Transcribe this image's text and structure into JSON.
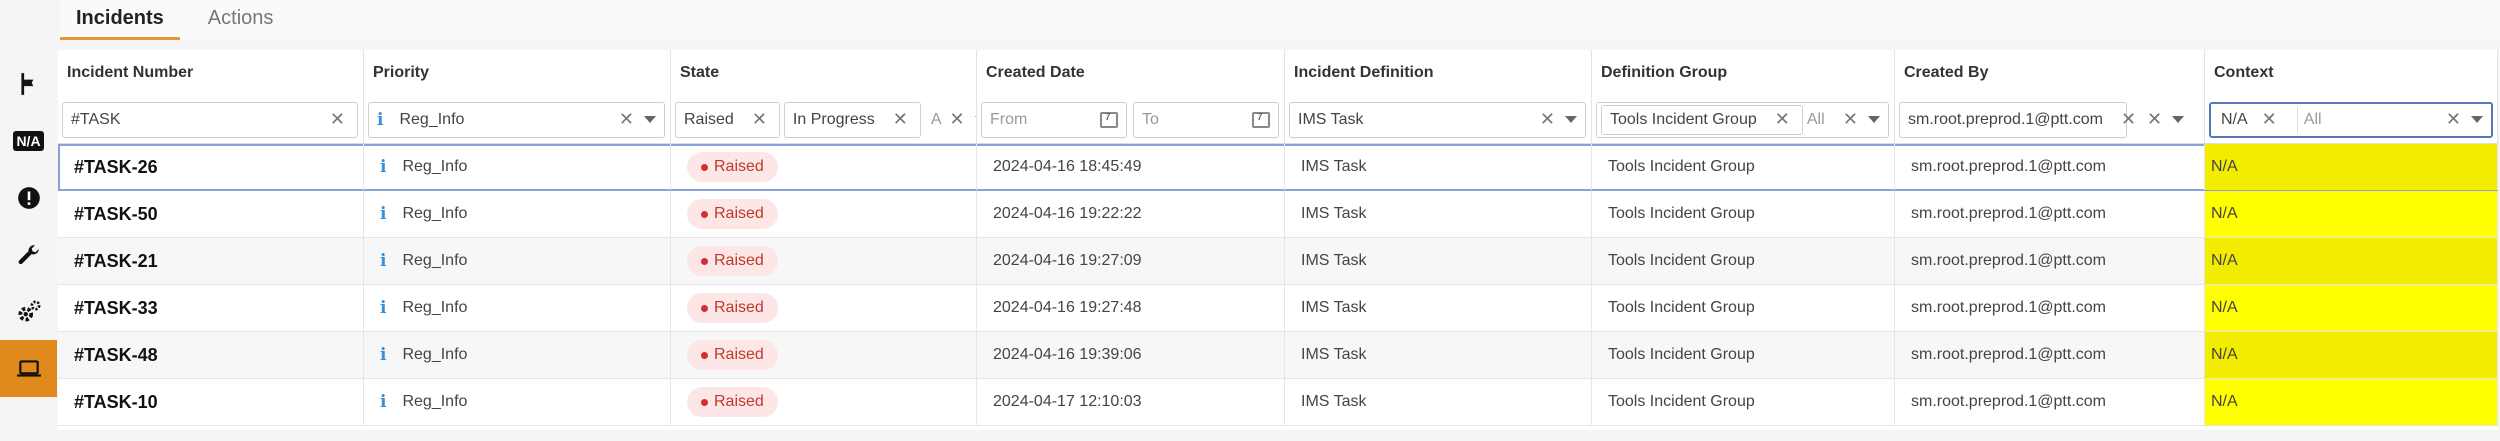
{
  "tabs": [
    {
      "label": "Incidents",
      "active": true
    },
    {
      "label": "Actions",
      "active": false
    }
  ],
  "sidebar": {
    "items": [
      {
        "icon": "flag-icon"
      },
      {
        "icon": "na-icon",
        "text": "N/A"
      },
      {
        "icon": "alert-icon"
      },
      {
        "icon": "wrench-icon"
      },
      {
        "icon": "gears-icon"
      },
      {
        "icon": "laptop-icon",
        "active": true
      }
    ]
  },
  "columns": [
    "Incident Number",
    "Priority",
    "State",
    "Created Date",
    "Incident Definition",
    "Definition Group",
    "Created By",
    "Context"
  ],
  "filters": {
    "incident_number": "#TASK",
    "priority": "Reg_Info",
    "state_chips": [
      "Raised",
      "In Progress"
    ],
    "state_more": "A",
    "date_from_placeholder": "From",
    "date_to_placeholder": "To",
    "incident_definition": "IMS Task",
    "definition_group_chip": "Tools Incident Group",
    "definition_group_all": "All",
    "created_by": "sm.root.preprod.1@ptt.com",
    "context_chip": "N/A",
    "context_all": "All"
  },
  "rows": [
    {
      "number": "#TASK-26",
      "priority": "Reg_Info",
      "state": "Raised",
      "created": "2024-04-16 18:45:49",
      "definition": "IMS Task",
      "group": "Tools Incident Group",
      "created_by": "sm.root.preprod.1@ptt.com",
      "context": "N/A"
    },
    {
      "number": "#TASK-50",
      "priority": "Reg_Info",
      "state": "Raised",
      "created": "2024-04-16 19:22:22",
      "definition": "IMS Task",
      "group": "Tools Incident Group",
      "created_by": "sm.root.preprod.1@ptt.com",
      "context": "N/A"
    },
    {
      "number": "#TASK-21",
      "priority": "Reg_Info",
      "state": "Raised",
      "created": "2024-04-16 19:27:09",
      "definition": "IMS Task",
      "group": "Tools Incident Group",
      "created_by": "sm.root.preprod.1@ptt.com",
      "context": "N/A"
    },
    {
      "number": "#TASK-33",
      "priority": "Reg_Info",
      "state": "Raised",
      "created": "2024-04-16 19:27:48",
      "definition": "IMS Task",
      "group": "Tools Incident Group",
      "created_by": "sm.root.preprod.1@ptt.com",
      "context": "N/A"
    },
    {
      "number": "#TASK-48",
      "priority": "Reg_Info",
      "state": "Raised",
      "created": "2024-04-16 19:39:06",
      "definition": "IMS Task",
      "group": "Tools Incident Group",
      "created_by": "sm.root.preprod.1@ptt.com",
      "context": "N/A"
    },
    {
      "number": "#TASK-10",
      "priority": "Reg_Info",
      "state": "Raised",
      "created": "2024-04-17 12:10:03",
      "definition": "IMS Task",
      "group": "Tools Incident Group",
      "created_by": "sm.root.preprod.1@ptt.com",
      "context": "N/A"
    }
  ],
  "colors": {
    "accent": "#e08a1e",
    "highlight": "#ffff00",
    "raised_bg": "#fde6e6",
    "raised_text": "#c0392b",
    "info_blue": "#3d8fd6"
  }
}
